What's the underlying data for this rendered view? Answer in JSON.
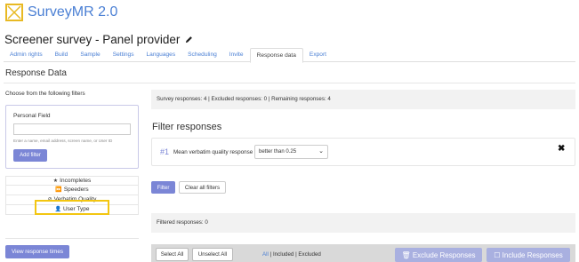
{
  "app": {
    "name": "SurveyMR 2.0",
    "logo_icon": "x-box-logo",
    "brand_color": "#4a7fd4",
    "accent_color": "#7b86d6",
    "highlight_color": "#f3c611"
  },
  "page": {
    "title": "Screener survey - Panel provider",
    "edit_icon": "pencil-icon"
  },
  "tabs": [
    {
      "label": "Admin rights",
      "active": false
    },
    {
      "label": "Build",
      "active": false
    },
    {
      "label": "Sample",
      "active": false
    },
    {
      "label": "Settings",
      "active": false
    },
    {
      "label": "Languages",
      "active": false
    },
    {
      "label": "Scheduling",
      "active": false
    },
    {
      "label": "Invite",
      "active": false
    },
    {
      "label": "Response data",
      "active": true
    },
    {
      "label": "Export",
      "active": false
    }
  ],
  "section_title": "Response Data",
  "left": {
    "filters_heading": "Choose from the following filters",
    "personal_field": {
      "label": "Personal Field",
      "value": "",
      "hint": "Enter a name, email address, screen name, or User ID",
      "add_button": "Add filter"
    },
    "filter_list": [
      {
        "label": "Incompletes",
        "icon": "star-half-icon",
        "glyph": "★"
      },
      {
        "label": "Speeders",
        "icon": "fast-forward-icon",
        "glyph": "⏩"
      },
      {
        "label": "Verbatim Quality",
        "icon": "check-circle-icon",
        "glyph": "⊘"
      },
      {
        "label": "User Type",
        "icon": "user-icon",
        "glyph": "👤"
      }
    ],
    "view_times_button": "View response times"
  },
  "right": {
    "stats": "Survey responses:  4  | Excluded responses:  0  | Remaining responses:  4",
    "filter_title": "Filter responses",
    "active_filter": {
      "number": "#1",
      "label": "Mean verbatim quality response",
      "selected": "better than 0.25",
      "close_icon": "close-icon"
    },
    "filter_button": "Filter",
    "clear_button": "Clear all filters",
    "filtered": "Filtered responses:  0",
    "actions": {
      "select_all": "Select All",
      "unselect_all": "Unselect All",
      "link_all": "All",
      "sep1": " | ",
      "link_included": "Included",
      "sep2": " | ",
      "link_excluded": "Excluded",
      "exclude_button": "Exclude Responses",
      "include_button": "Include Responses"
    }
  }
}
